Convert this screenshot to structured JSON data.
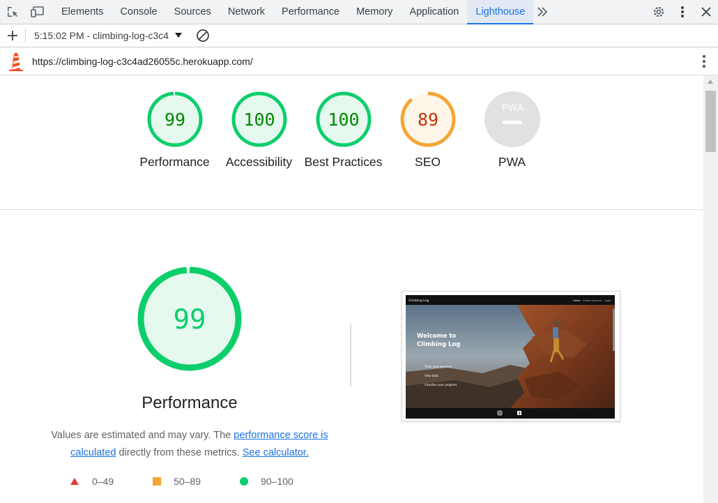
{
  "devtools": {
    "tabs": [
      "Elements",
      "Console",
      "Sources",
      "Network",
      "Performance",
      "Memory",
      "Application",
      "Lighthouse"
    ],
    "active_tab": "Lighthouse",
    "icons": {
      "inspect": "inspect-element-icon",
      "device": "device-toolbar-icon",
      "more_tabs": "more-tabs-icon",
      "settings": "gear-icon",
      "menu": "kebab-menu-icon",
      "close": "close-icon"
    }
  },
  "toolbar": {
    "report_select": "5:15:02 PM - climbing-log-c3c4",
    "icons": {
      "new_report": "plus-icon",
      "dropdown": "caret-down-icon",
      "clear": "clear-icon"
    }
  },
  "urlbar": {
    "url": "https://climbing-log-c3c4ad26055c.herokuapp.com/",
    "icons": {
      "logo": "lighthouse-logo-icon",
      "menu": "kebab-menu-icon"
    }
  },
  "scores": [
    {
      "label": "Performance",
      "value": "99",
      "fraction": 0.99,
      "status": "pass"
    },
    {
      "label": "Accessibility",
      "value": "100",
      "fraction": 1.0,
      "status": "pass"
    },
    {
      "label": "Best Practices",
      "value": "100",
      "fraction": 1.0,
      "status": "pass"
    },
    {
      "label": "SEO",
      "value": "89",
      "fraction": 0.89,
      "status": "average"
    },
    {
      "label": "PWA",
      "value": "",
      "fraction": 0,
      "status": "na"
    }
  ],
  "performance": {
    "score": "99",
    "fraction": 0.99,
    "title": "Performance",
    "desc_prefix": "Values are estimated and may vary. The ",
    "desc_link1": "performance score is calculated",
    "desc_middle": " directly from these metrics. ",
    "desc_link2": "See calculator."
  },
  "legend": [
    {
      "range": "0–49",
      "shape": "triangle",
      "color": "#e53935"
    },
    {
      "range": "50–89",
      "shape": "square",
      "color": "#f4a534"
    },
    {
      "range": "90–100",
      "shape": "circle",
      "color": "#0cce6b"
    }
  ],
  "thumbnail": {
    "site_name": "Climbing Log",
    "nav": [
      "Home",
      "Create account",
      "Login"
    ],
    "hero_title_line1": "Welcome to",
    "hero_title_line2": "Climbing Log",
    "features": [
      "Track your sessions",
      "View data",
      "Visualise your progress"
    ],
    "footer_icons": [
      "instagram-icon",
      "facebook-icon"
    ]
  },
  "colors": {
    "pass": "#0cce6b",
    "pass_text": "#008800",
    "pass_bg": "#e5f9ee",
    "average": "#f4a534",
    "average_text": "#c33300",
    "average_bg": "#fff6ea",
    "na": "#e1e1e1",
    "accent": "#1a73e8"
  }
}
